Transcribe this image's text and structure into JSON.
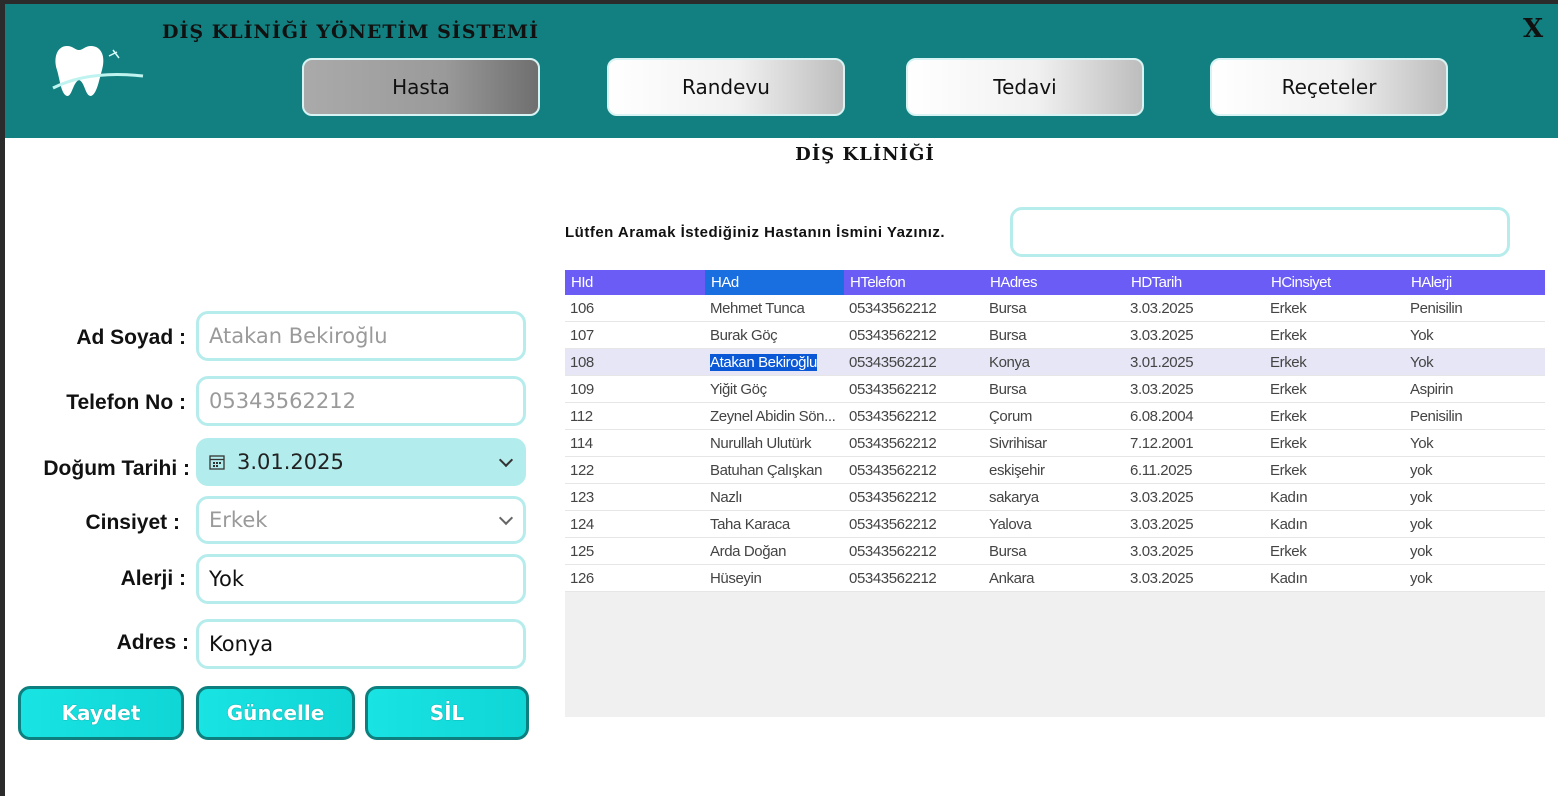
{
  "header": {
    "app_title": "DİŞ KLİNİĞİ YÖNETİM SİSTEMİ",
    "close_label": "X",
    "nav": [
      "Hasta",
      "Randevu",
      "Tedavi",
      "Reçeteler"
    ]
  },
  "section_title": "DİŞ KLİNİĞİ",
  "form": {
    "ad_soyad_label": "Ad Soyad :",
    "ad_soyad_value": "Atakan Bekiroğlu",
    "telefon_label": "Telefon No :",
    "telefon_value": "05343562212",
    "dogum_label": "Doğum Tarihi :",
    "dogum_value": "3.01.2025",
    "cinsiyet_label": "Cinsiyet :",
    "cinsiyet_value": "Erkek",
    "alerji_label": "Alerji :",
    "alerji_value": "Yok",
    "adres_label": "Adres :",
    "adres_value": "Konya"
  },
  "actions": {
    "save": "Kaydet",
    "update": "Güncelle",
    "delete": "SİL"
  },
  "search": {
    "label": "Lütfen Aramak İstediğiniz Hastanın İsmini Yazınız.",
    "value": ""
  },
  "table": {
    "columns": [
      "HId",
      "HAd",
      "HTelefon",
      "HAdres",
      "HDTarih",
      "HCinsiyet",
      "HAlerji"
    ],
    "rows": [
      [
        "106",
        "Mehmet Tunca",
        "05343562212",
        "Bursa",
        "3.03.2025",
        "Erkek",
        "Penisilin"
      ],
      [
        "107",
        "Burak Göç",
        "05343562212",
        "Bursa",
        "3.03.2025",
        "Erkek",
        "Yok"
      ],
      [
        "108",
        "Atakan Bekiroğlu",
        "05343562212",
        "Konya",
        "3.01.2025",
        "Erkek",
        "Yok"
      ],
      [
        "109",
        "Yiğit Göç",
        "05343562212",
        "Bursa",
        "3.03.2025",
        "Erkek",
        "Aspirin"
      ],
      [
        "112",
        "Zeynel Abidin Sön...",
        "05343562212",
        "Çorum",
        "6.08.2004",
        "Erkek",
        "Penisilin"
      ],
      [
        "114",
        "Nurullah Ulutürk",
        "05343562212",
        "Sivrihisar",
        "7.12.2001",
        "Erkek",
        "Yok"
      ],
      [
        "122",
        "Batuhan Çalışkan",
        "05343562212",
        "eskişehir",
        "6.11.2025",
        "Erkek",
        "yok"
      ],
      [
        "123",
        "Nazlı",
        "05343562212",
        "sakarya",
        "3.03.2025",
        "Kadın",
        "yok"
      ],
      [
        "124",
        "Taha Karaca",
        "05343562212",
        "Yalova",
        "3.03.2025",
        "Kadın",
        "yok"
      ],
      [
        "125",
        "Arda Doğan",
        "05343562212",
        "Bursa",
        "3.03.2025",
        "Erkek",
        "yok"
      ],
      [
        "126",
        "Hüseyin",
        "05343562212",
        "Ankara",
        "3.03.2025",
        "Kadın",
        "yok"
      ]
    ],
    "selected_row": 2
  },
  "colors": {
    "header_bg": "#128080",
    "grid_header": "#6a5cf5",
    "accent_cyan": "#10d6d6",
    "selection": "#0a58d6"
  }
}
